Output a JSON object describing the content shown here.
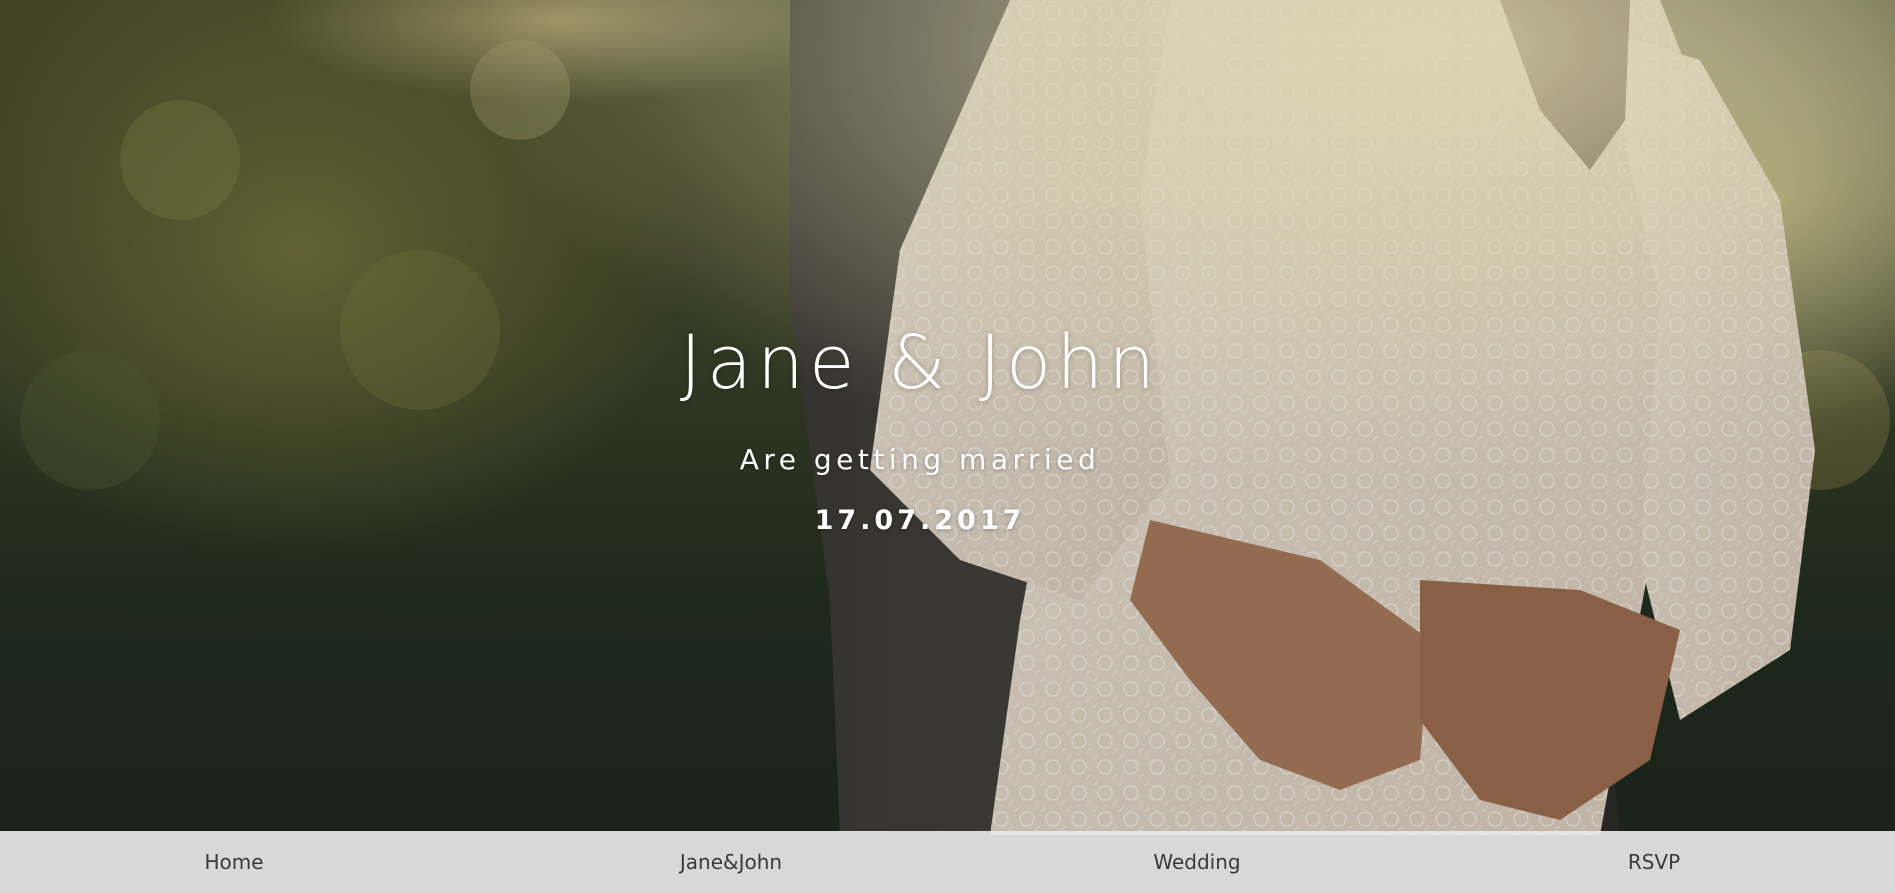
{
  "hero": {
    "title": "Jane & John",
    "subtitle": "Are getting married",
    "date": "17.07.2017"
  },
  "nav": {
    "items": [
      {
        "label": "Home"
      },
      {
        "label": "Jane&John"
      },
      {
        "label": "Wedding"
      },
      {
        "label": "RSVP"
      }
    ]
  }
}
